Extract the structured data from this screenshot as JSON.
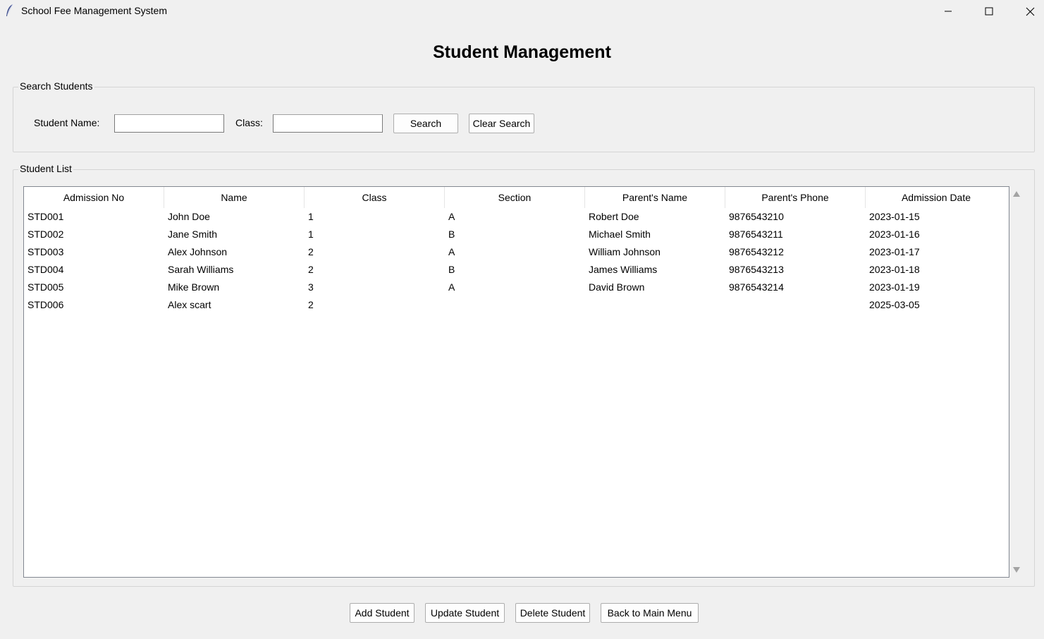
{
  "window": {
    "title": "School Fee Management System",
    "icon": "feather-icon"
  },
  "heading": "Student Management",
  "search": {
    "legend": "Search Students",
    "name_label": "Student Name:",
    "name_value": "",
    "class_label": "Class:",
    "class_value": "",
    "search_button": "Search",
    "clear_button": "Clear Search"
  },
  "list": {
    "legend": "Student List",
    "columns": [
      "Admission No",
      "Name",
      "Class",
      "Section",
      "Parent's Name",
      "Parent's Phone",
      "Admission Date"
    ],
    "rows": [
      [
        "STD001",
        "John Doe",
        "1",
        "A",
        "Robert Doe",
        "9876543210",
        "2023-01-15"
      ],
      [
        "STD002",
        "Jane Smith",
        "1",
        "B",
        "Michael Smith",
        "9876543211",
        "2023-01-16"
      ],
      [
        "STD003",
        "Alex Johnson",
        "2",
        "A",
        "William Johnson",
        "9876543212",
        "2023-01-17"
      ],
      [
        "STD004",
        "Sarah Williams",
        "2",
        "B",
        "James Williams",
        "9876543213",
        "2023-01-18"
      ],
      [
        "STD005",
        "Mike Brown",
        "3",
        "A",
        "David Brown",
        "9876543214",
        "2023-01-19"
      ],
      [
        "STD006",
        "Alex scart",
        "2",
        "",
        "",
        "",
        "2025-03-05"
      ]
    ]
  },
  "actions": {
    "add": "Add Student",
    "update": "Update Student",
    "delete": "Delete Student",
    "back": "Back to Main Menu"
  }
}
